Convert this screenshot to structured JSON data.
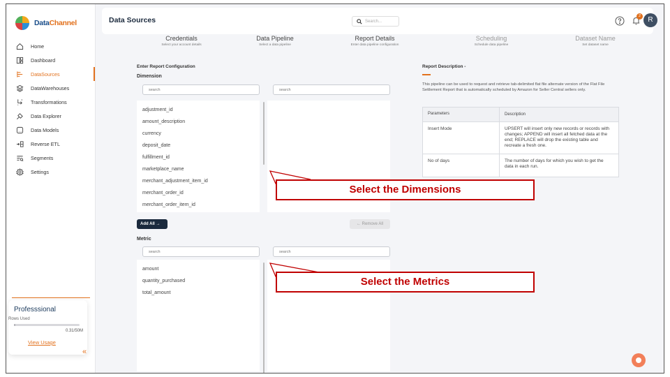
{
  "brand": {
    "part1": "Data",
    "part2": "Channel"
  },
  "sidebar": {
    "items": [
      {
        "label": "Home",
        "icon": "home-icon",
        "active": false
      },
      {
        "label": "Dashboard",
        "icon": "dashboard-icon",
        "active": false
      },
      {
        "label": "DataSources",
        "icon": "datasource-icon",
        "active": true
      },
      {
        "label": "DataWarehouses",
        "icon": "warehouse-icon",
        "active": false
      },
      {
        "label": "Transformations",
        "icon": "transform-icon",
        "active": false
      },
      {
        "label": "Data Explorer",
        "icon": "explorer-icon",
        "active": false
      },
      {
        "label": "Data Models",
        "icon": "models-icon",
        "active": false
      },
      {
        "label": "Reverse ETL",
        "icon": "reverse-etl-icon",
        "active": false
      },
      {
        "label": "Segments",
        "icon": "segments-icon",
        "active": false
      },
      {
        "label": "Settings",
        "icon": "gear-icon",
        "active": false
      }
    ],
    "plan": {
      "title": "Professsional",
      "rows_label": "Rows Used",
      "usage": "0.31/50M",
      "usage_fraction": 0.006,
      "link": "View Usage"
    }
  },
  "header": {
    "title": "Data Sources",
    "search_placeholder": "Search...",
    "notifications": "2",
    "avatar": "R"
  },
  "steps": [
    {
      "title": "Credentials",
      "sub": "Select your account details",
      "muted": false
    },
    {
      "title": "Data Pipeline",
      "sub": "Select a data pipeline",
      "muted": false
    },
    {
      "title": "Report Details",
      "sub": "Enter data pipeline configuration",
      "muted": false
    },
    {
      "title": "Scheduling",
      "sub": "Schedule data pipeline",
      "muted": true
    },
    {
      "title": "Dataset Name",
      "sub": "Set dataset name",
      "muted": true
    }
  ],
  "config": {
    "heading": "Enter Report Configuration",
    "dimension_label": "Dimension",
    "metric_label": "Metric",
    "search_placeholder": "search",
    "dimensions": [
      "adjustment_id",
      "amount_description",
      "currency",
      "deposit_date",
      "fulfillment_id",
      "marketplace_name",
      "merchant_adjustment_item_id",
      "merchant_order_id",
      "merchant_order_item_id"
    ],
    "metrics": [
      "amount",
      "quantity_purchased",
      "total_amount"
    ],
    "add_all": "Add All →",
    "remove_all": "← Remove All"
  },
  "description": {
    "title": "Report Description -",
    "text": "This pipeline can be used to request and retrieve tab-delimited flat file alternate version of the Flat File Settlement Report that is automatically scheduled by Amazon for Seller Central sellers only.",
    "headers": [
      "Parameters",
      "Description"
    ],
    "rows": [
      {
        "param": "Insert Mode",
        "desc": "UPSERT will insert only new records or records with changes; APPEND will insert all fetched data at the end; REPLACE will drop the existing table and recreate a fresh one."
      },
      {
        "param": "No of days",
        "desc": "The number of days for which you wish to get the data in each run."
      }
    ]
  },
  "annotations": {
    "dimensions": "Select the Dimensions",
    "metrics": "Select the Metrics"
  },
  "colors": {
    "accent": "#e2711d",
    "annotation": "#c00000",
    "navy": "#1b2a3d"
  }
}
